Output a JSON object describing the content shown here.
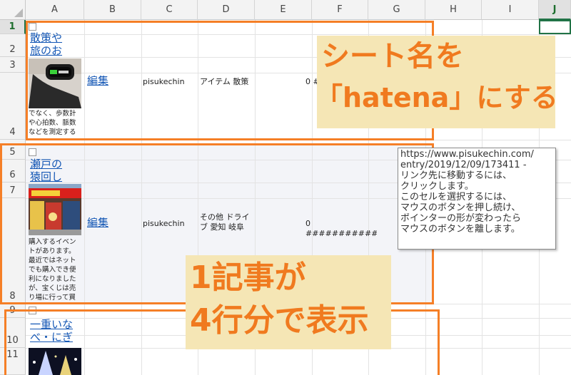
{
  "columns": [
    "A",
    "B",
    "C",
    "D",
    "E",
    "F",
    "G",
    "H",
    "I",
    "J"
  ],
  "active_column": "J",
  "rows": [
    "1",
    "2",
    "3",
    "4",
    "5",
    "6",
    "7",
    "8",
    "9",
    "10",
    "11"
  ],
  "active_row": "1",
  "records": [
    {
      "title_lines": [
        "散策や",
        "旅のお"
      ],
      "desc_lines": [
        "でなく、歩数計",
        "や心拍数、脈数",
        "などを測定する"
      ],
      "edit": "編集",
      "user": "pisukechin",
      "category_lines": [
        "アイテム 散策"
      ],
      "num": "0 #",
      "thumb": "smartband-image"
    },
    {
      "title_lines": [
        "瀬戸の",
        "猿回し"
      ],
      "desc_lines": [
        "購入するイベン",
        "トがあります。",
        "最近ではネット",
        "でも購入でき便",
        "利になりました",
        "が、宝くじは売",
        "り場に行って買"
      ],
      "edit": "編集",
      "user": "pisukechin",
      "category_lines": [
        "その他 ドライ",
        "ブ 愛知 岐阜"
      ],
      "num": "0 ###########",
      "thumb": "shop-storefront-image"
    },
    {
      "title_lines": [
        "一重いな",
        "べ・にぎ"
      ],
      "thumb": "illumination-image"
    }
  ],
  "tooltip_lines": [
    "https://www.pisukechin.com/",
    "entry/2019/12/09/173411 -",
    "リンク先に移動するには、",
    "クリックします。",
    "このセルを選択するには、",
    "マウスのボタンを押し続け、",
    "ポインターの形が変わったら",
    "マウスのボタンを離します。"
  ],
  "annotations": {
    "top": [
      "シート名を",
      "「hatena」にする"
    ],
    "bottom": [
      "1記事が",
      "4行分で表示"
    ]
  },
  "colors": {
    "accent": "#f57f27",
    "note_bg": "#f5e6b5",
    "link": "#1457b5",
    "excel_green": "#217346"
  }
}
